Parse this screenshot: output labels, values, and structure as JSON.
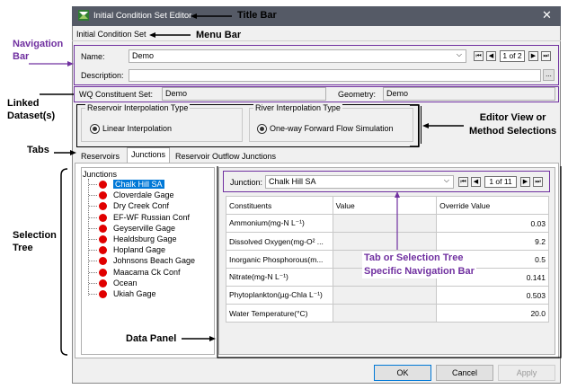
{
  "window": {
    "title": "Initial Condition Set Editor",
    "menu": "Initial Condition Set"
  },
  "navigation": {
    "name_label": "Name:",
    "name_value": "Demo",
    "description_label": "Description:",
    "page": "1 of 2",
    "ellipsis": "..."
  },
  "linked": {
    "wq_label": "WQ Constituent Set:",
    "wq_value": "Demo",
    "geometry_label": "Geometry:",
    "geometry_value": "Demo"
  },
  "methods": {
    "reservoir_group": "Reservoir Interpolation Type",
    "reservoir_option": "Linear Interpolation",
    "river_group": "River Interpolation Type",
    "river_option": "One-way Forward Flow Simulation"
  },
  "tabs": [
    "Reservoirs",
    "Junctions",
    "Reservoir Outflow Junctions"
  ],
  "tree": {
    "root": "Junctions",
    "items": [
      "Chalk Hill SA",
      "Cloverdale Gage",
      "Dry Creek Conf",
      "EF-WF Russian Conf",
      "Geyserville Gage",
      "Healdsburg Gage",
      "Hopland Gage",
      "Johnsons Beach Gage",
      "Maacama Ck Conf",
      "Ocean",
      "Ukiah Gage"
    ]
  },
  "panel": {
    "junction_label": "Junction:",
    "junction_value": "Chalk Hill SA",
    "page": "1 of 11",
    "headers": [
      "Constituents",
      "Value",
      "Override Value"
    ],
    "rows": [
      {
        "name": "Ammonium(mg-N L⁻¹)",
        "value": "",
        "override": "0.03"
      },
      {
        "name": "Dissolved Oxygen(mg-O² ...",
        "value": "",
        "override": "9.2"
      },
      {
        "name": "Inorganic Phosphorous(m...",
        "value": "",
        "override": "0.5"
      },
      {
        "name": "Nitrate(mg-N L⁻¹)",
        "value": "",
        "override": "0.141"
      },
      {
        "name": "Phytoplankton(µg-Chla L⁻¹)",
        "value": "",
        "override": "0.503"
      },
      {
        "name": "Water Temperature(°C)",
        "value": "",
        "override": "20.0"
      }
    ]
  },
  "buttons": {
    "ok": "OK",
    "cancel": "Cancel",
    "apply": "Apply"
  },
  "callouts": {
    "title_bar": "Title Bar",
    "menu_bar": "Menu Bar",
    "navigation_bar": "Navigation\nBar",
    "linked": "Linked\nDataset(s)",
    "editor_view": "Editor View or\nMethod Selections",
    "tabs": "Tabs",
    "selection_tree": "Selection\nTree",
    "data_panel": "Data Panel",
    "tab_nav": "Tab or Selection Tree\nSpecific Navigation Bar"
  },
  "colors": {
    "titlebar": "#555a66",
    "annotation_purple": "#7030a0",
    "selected": "#0078d7",
    "tree_dot": "#e00000"
  }
}
